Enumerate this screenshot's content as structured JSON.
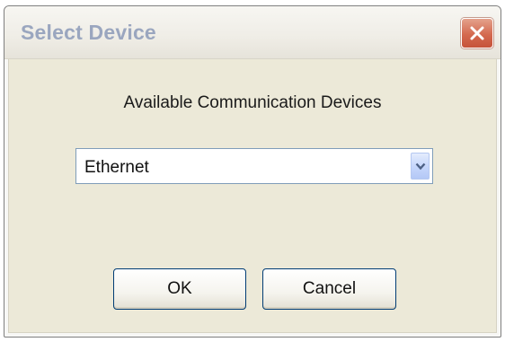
{
  "dialog": {
    "title": "Select Device",
    "close_icon": "close-icon",
    "prompt": "Available Communication Devices",
    "device_select": {
      "selected": "Ethernet",
      "dropdown_icon": "chevron-down-icon"
    },
    "buttons": {
      "ok_label": "OK",
      "cancel_label": "Cancel"
    }
  },
  "colors": {
    "title_text": "#9aa6bf",
    "close_button": "#d4694f",
    "dialog_background": "#ece9d8",
    "button_border": "#003c74"
  }
}
